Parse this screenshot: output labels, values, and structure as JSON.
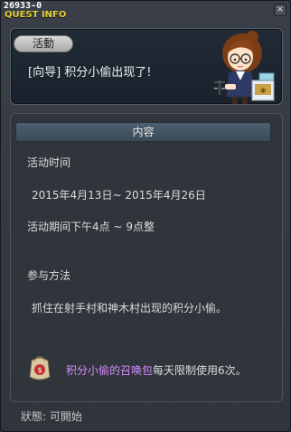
{
  "window": {
    "quest_id": "26933-0",
    "title": "QUEST INFO",
    "close_glyph": "×"
  },
  "quest": {
    "category": "活動",
    "title": "[向导] 积分小偷出现了!"
  },
  "content": {
    "header": "内容",
    "period_label": "活动时间",
    "period_dates": "2015年4月13日~ 2015年4月26日",
    "period_hours": "活动期间下午4点 ~ 9点整",
    "method_label": "参与方法",
    "method_text": "抓住在射手村和神木村出现的积分小偷。",
    "reward_item": "积分小偷的召唤包",
    "reward_text": "每天限制使用6次。"
  },
  "status": {
    "text": "狀態: 可開始"
  },
  "colors": {
    "title_yellow": "#e8d238",
    "reward_purple": "#d78cff"
  },
  "icons": {
    "npc": "npc-portrait-icon",
    "reward": "summon-bag-icon"
  }
}
